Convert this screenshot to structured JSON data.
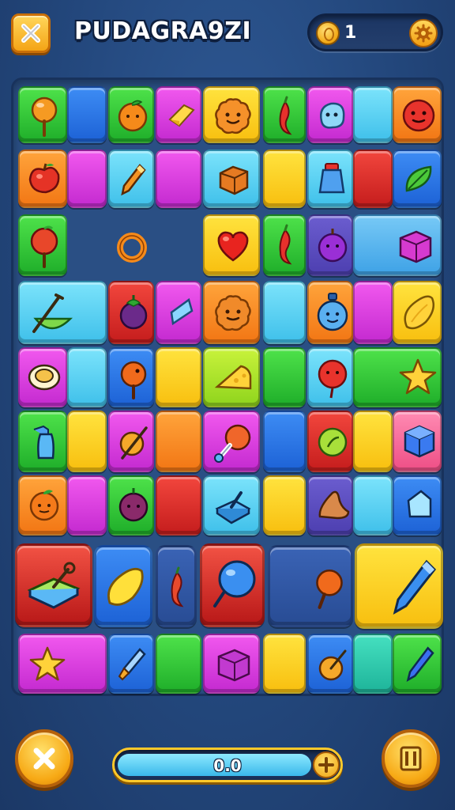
{
  "header": {
    "title": "PUDAGRA9ZI",
    "coins": "1"
  },
  "footer": {
    "progress_label": "0.0",
    "progress_value": 0.88
  },
  "colors": {
    "background": "#23477c",
    "accent_gold": "#f7a915",
    "board": "#2a4f84"
  },
  "board": {
    "tiles": [
      {
        "row": 1,
        "col": 1,
        "color": "green",
        "icon": "lollipop-icon"
      },
      {
        "row": 1,
        "col": 2,
        "color": "blue",
        "icon": ""
      },
      {
        "row": 1,
        "col": 3,
        "color": "green",
        "icon": "orange-fruit-icon"
      },
      {
        "row": 1,
        "col": 4,
        "color": "magenta",
        "icon": "cheese-block-icon"
      },
      {
        "row": 1,
        "col": 5,
        "color": "yellow",
        "icon": "cookie-face-icon"
      },
      {
        "row": 1,
        "col": 6,
        "color": "green",
        "icon": "chili-icon"
      },
      {
        "row": 1,
        "col": 7,
        "color": "magenta",
        "icon": "blob-icon"
      },
      {
        "row": 1,
        "col": 8,
        "color": "cyan",
        "icon": ""
      },
      {
        "row": 1,
        "col": 9,
        "color": "orange",
        "icon": "red-ball-face-icon"
      },
      {
        "row": 2,
        "col": 1,
        "color": "orange",
        "icon": "apple-icon"
      },
      {
        "row": 2,
        "col": 2,
        "color": "magenta",
        "icon": ""
      },
      {
        "row": 2,
        "col": 3,
        "color": "cyan",
        "icon": "crayon-icon"
      },
      {
        "row": 2,
        "col": 4,
        "color": "magenta",
        "icon": ""
      },
      {
        "row": 2,
        "col": 5,
        "color": "cyan",
        "icon": "box-icon"
      },
      {
        "row": 2,
        "col": 6,
        "color": "yellow",
        "icon": ""
      },
      {
        "row": 2,
        "col": 7,
        "color": "cyan",
        "icon": "jar-icon"
      },
      {
        "row": 2,
        "col": 8,
        "color": "red",
        "icon": ""
      },
      {
        "row": 2,
        "col": 9,
        "color": "blue",
        "icon": "leaf-icon"
      }
    ]
  }
}
